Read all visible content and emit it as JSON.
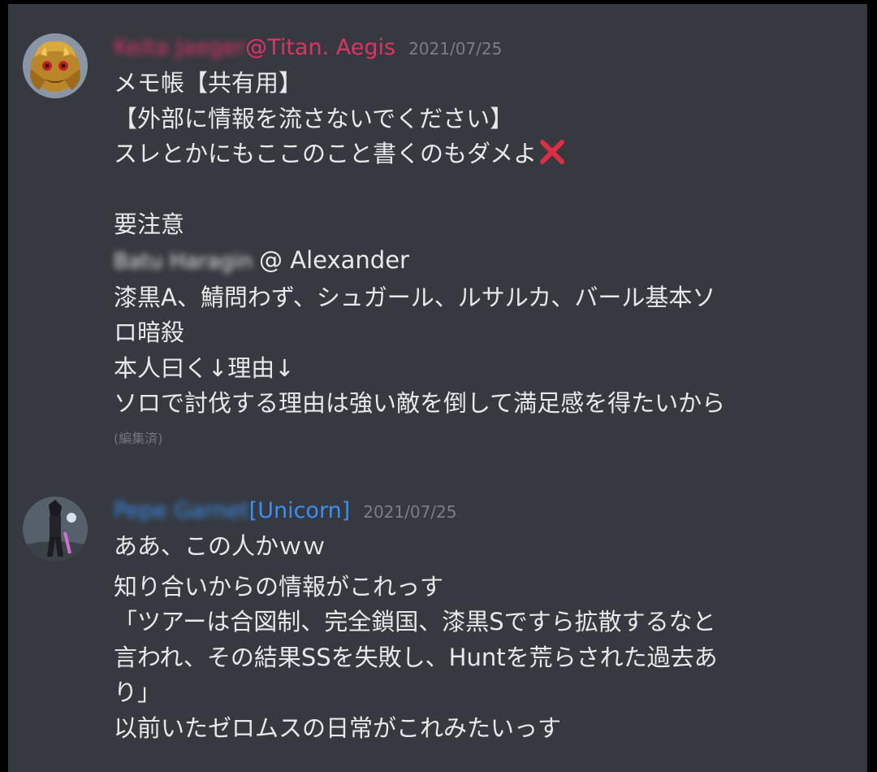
{
  "colors": {
    "background": "#36393f",
    "author1": "#e03364",
    "author2": "#3d8ef2",
    "text": "#e7e8ea",
    "timestamp": "#7b7e85",
    "xmark": "#dd2e44"
  },
  "messages": [
    {
      "author_blurred": "Keita Jaeger",
      "author_suffix": "@Titan. Aegis",
      "timestamp": "2021/07/25",
      "avatar_icon": "dragon-avatar-icon",
      "lines": {
        "l1": "メモ帳【共有用】",
        "l2": "【外部に情報を流さないでください】",
        "l3": "スレとかにもここのこと書くのもダメよ",
        "l4": "要注意",
        "l5_blurred": "Batu Haragin",
        "l5_suffix": "@ Alexander",
        "l6": "漆黒A、鯖問わず、シュガール、ルサルカ、バール基本ソ",
        "l7": "ロ暗殺",
        "l8": "本人曰く↓理由↓",
        "l9": "ソロで討伐する理由は強い敵を倒して満足感を得たいから"
      },
      "edited": "(編集済)"
    },
    {
      "author_blurred": "Pepe Garnet",
      "author_suffix": "[Unicorn]",
      "timestamp": "2021/07/25",
      "avatar_icon": "character-avatar-icon",
      "lines": {
        "l1": "ああ、この人かｗｗ",
        "l2": "知り合いからの情報がこれっす",
        "l3": "「ツアーは合図制、完全鎖国、漆黒Sですら拡散するなと",
        "l4": "言われ、その結果SSを失敗し、Huntを荒らされた過去あ",
        "l5": "り」",
        "l6": "以前いたゼロムスの日常がこれみたいっす"
      }
    }
  ]
}
